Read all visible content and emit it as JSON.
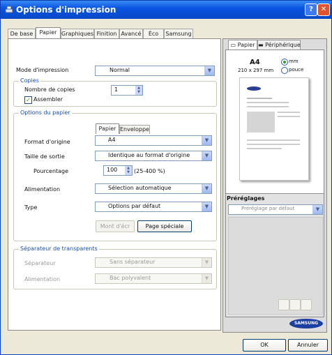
{
  "window": {
    "title": "Options d'impression",
    "help_glyph": "?",
    "close_glyph": "✕"
  },
  "tabs": [
    "De base",
    "Papier",
    "Graphiques",
    "Finition",
    "Avancé",
    "Éco",
    "Samsung"
  ],
  "print_mode": {
    "label": "Mode d'impression",
    "value": "Normal"
  },
  "copies": {
    "group_title": "Copies",
    "count_label": "Nombre de copies",
    "count_value": "1",
    "collate_label": "Assembler",
    "collate_checked": true
  },
  "paper_options": {
    "group_title": "Options du papier",
    "subtabs": [
      "Papier",
      "Enveloppe"
    ],
    "original_format": {
      "label": "Format d'origine",
      "value": "A4"
    },
    "output_size": {
      "label": "Taille de sortie",
      "value": "Identique au format d'origine"
    },
    "percentage": {
      "label": "Pourcentage",
      "value": "100",
      "range": "(25-400 %)"
    },
    "source": {
      "label": "Alimentation",
      "value": "Sélection automatique"
    },
    "type": {
      "label": "Type",
      "value": "Options par défaut"
    },
    "buttons": {
      "cover": "Mont d'écr",
      "special": "Page spéciale"
    }
  },
  "transparency": {
    "group_title": "Séparateur de transparents",
    "separator_label": "Séparateur",
    "separator_value": "Sans séparateur",
    "source_label": "Alimentation",
    "source_value": "Bac polyvalent"
  },
  "right_panel": {
    "tabs": [
      "Papier",
      "Périphérique"
    ],
    "paper_name": "A4",
    "paper_dims": "210 x 297 mm",
    "unit_mm": "mm",
    "unit_inch": "pouce",
    "logo": "SAMSUNG",
    "presets_title": "Préréglages",
    "presets_value": "Préréglage par défaut"
  },
  "footer": {
    "ok": "OK",
    "cancel": "Annuler"
  },
  "colors": {
    "title_bar": "#0a55e0",
    "accent": "#1a4fa8",
    "logo": "#1c3ea0",
    "check": "#21a121"
  }
}
